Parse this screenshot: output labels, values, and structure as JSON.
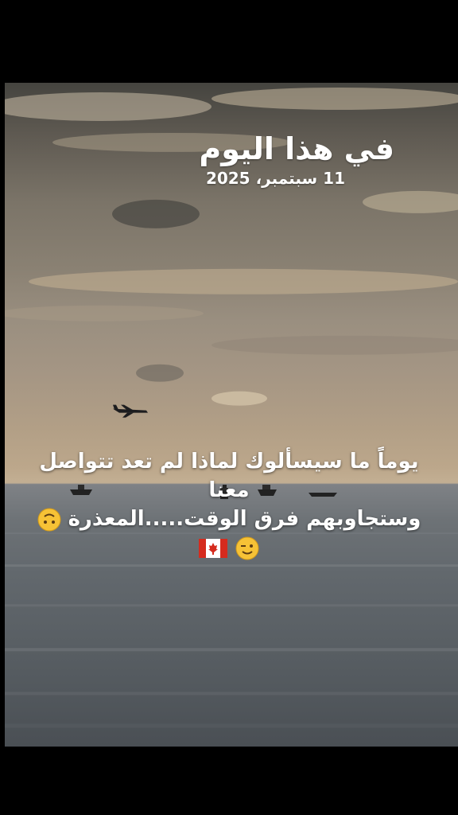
{
  "overlay": {
    "title": "في هذا اليوم",
    "date": "11 سبتمبر، 2025"
  },
  "caption": {
    "line1": "يوماً ما سيسألوك لماذا لم تعد تتواصل",
    "line2": "معنا",
    "line3": "وستجاوبهم فرق الوقت.....المعذرة",
    "line3_emoji": "upside-down-face",
    "line4_emojis": [
      "winking-face",
      "canada-flag"
    ]
  },
  "scene": {
    "elements": [
      "cloudy-sunset-sky",
      "airplane",
      "boats",
      "channel-marker-pole",
      "distant-ship",
      "calm-sea"
    ]
  }
}
